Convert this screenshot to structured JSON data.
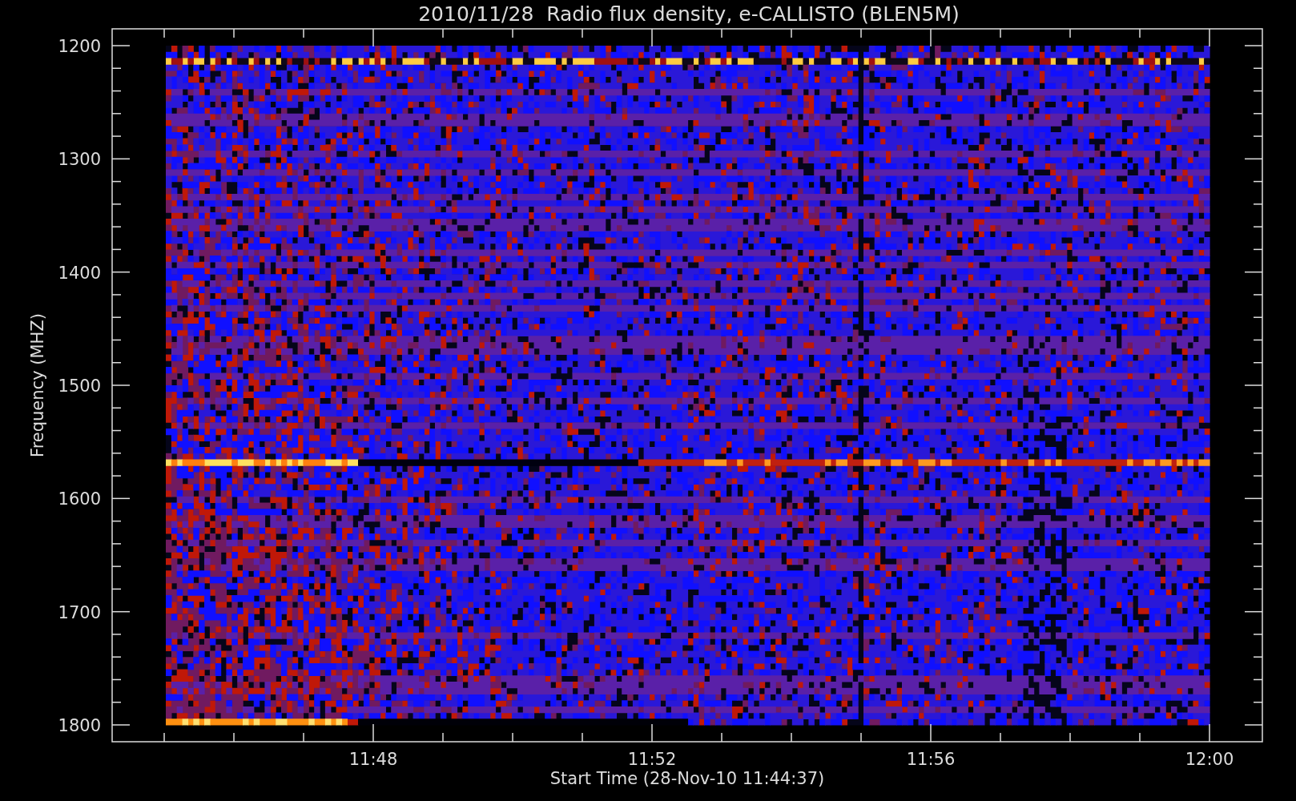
{
  "title": "2010/11/28  Radio flux density, e-CALLISTO (BLEN5M)",
  "ylabel": "Frequency (MHZ)",
  "xlabel": "Start Time (28-Nov-10 11:44:37)",
  "yticks": [
    "1200",
    "1300",
    "1400",
    "1500",
    "1600",
    "1700",
    "1800"
  ],
  "xticks": [
    "11:48",
    "11:52",
    "11:56",
    "12:00"
  ]
}
